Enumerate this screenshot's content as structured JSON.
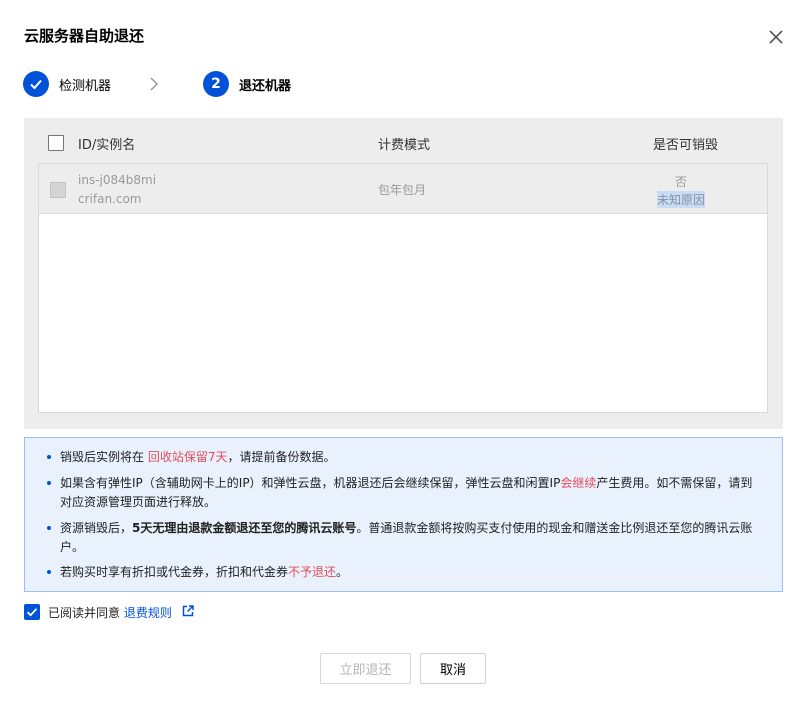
{
  "dialog": {
    "title": "云服务器自助退还"
  },
  "steps": [
    {
      "number": "1",
      "label": "检测机器",
      "status": "completed"
    },
    {
      "number": "2",
      "label": "退还机器",
      "status": "active"
    }
  ],
  "table": {
    "headers": {
      "id": "ID/实例名",
      "billing": "计费模式",
      "destroyable": "是否可销毁"
    },
    "rows": [
      {
        "id": "ins-j084b8mi",
        "name": "crifan.com",
        "billing": "包年包月",
        "destroyable": "否",
        "reason": "未知原因"
      }
    ]
  },
  "notice": {
    "items": [
      {
        "before": "销毁后实例将在 ",
        "highlight": "回收站保留7天",
        "after": "，请提前备份数据。"
      },
      {
        "line1a": "如果含有弹性IP（含辅助网卡上的IP）和弹性云盘，机器退还后会继续保留，弹性云盘和闲置IP",
        "line1red": "会继续",
        "line1b": "产生费用。如不需保留，请到",
        "line2": "对应资源管理页面进行释放。"
      },
      {
        "line1a": "资源销毁后，",
        "line1bold": "5天无理由退款金额退还至您的腾讯云账号",
        "line1b": "。普通退款金额将按购买支付使用的现金和赠送金比例退还至您的腾讯云账",
        "line2": "户。"
      },
      {
        "before": "若购买时享有折扣或代金券，折扣和代金券",
        "highlight": "不予退还",
        "after": "。"
      }
    ]
  },
  "agreement": {
    "checked": true,
    "text": "已阅读并同意 ",
    "link": "退费规则"
  },
  "buttons": {
    "confirm": "立即退还",
    "cancel": "取消"
  },
  "colors": {
    "primary": "#0052d9",
    "danger": "#e34d59",
    "notice_bg": "#e9f1fd",
    "notice_border": "#9dbdf3"
  },
  "icons": {
    "close": "close-icon",
    "step_done": "check-icon",
    "step_arrow": "chevron-right-icon",
    "external": "external-link-icon"
  }
}
